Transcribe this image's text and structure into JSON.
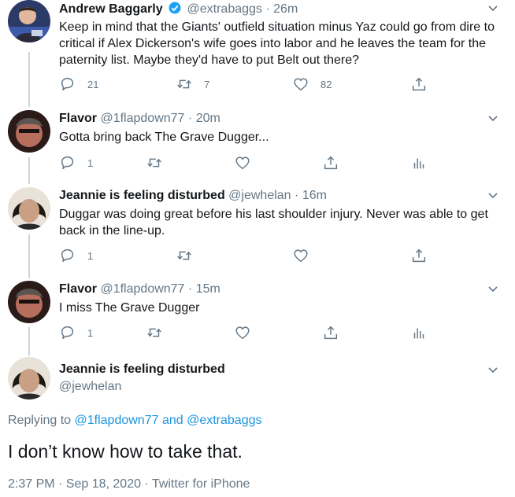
{
  "tweets": [
    {
      "name": "Andrew Baggarly",
      "handle": "@extrabaggs",
      "time": "26m",
      "verified": true,
      "text": "Keep in mind that the Giants' outfield situation minus Yaz could go from dire to critical if Alex Dickerson's wife goes into labor and he leaves the team for the paternity list. Maybe they'd have to put Belt out there?",
      "replies": "21",
      "retweets": "7",
      "likes": "82"
    },
    {
      "name": "Flavor",
      "handle": "@1flapdown77",
      "time": "20m",
      "text": "Gotta bring back The Grave Dugger...",
      "replies": "1"
    },
    {
      "name": "Jeannie is feeling disturbed",
      "handle": "@jewhelan",
      "time": "16m",
      "text": "Duggar was doing great before his last shoulder injury. Never was able to get back in the line-up.",
      "replies": "1"
    },
    {
      "name": "Flavor",
      "handle": "@1flapdown77",
      "time": "15m",
      "text": "I miss The Grave Dugger",
      "replies": "1"
    }
  ],
  "main_tweet": {
    "name": "Jeannie is feeling disturbed",
    "handle": "@jewhelan",
    "replying_prefix": "Replying to",
    "replying_user1": "@1flapdown77",
    "replying_and": "and",
    "replying_user2": "@extrabaggs",
    "text": "I don’t know how to take that.",
    "timestamp": "2:37 PM · Sep 18, 2020 · Twitter for iPhone"
  },
  "separator": "·",
  "colors": {
    "text": "#14171a",
    "secondary": "#657786",
    "link": "#1b95e0",
    "verified": "#1da1f2",
    "thread_line": "#ccd6dd"
  },
  "icons": [
    "reply-icon",
    "retweet-icon",
    "like-icon",
    "share-icon",
    "analytics-icon",
    "chevron-down-icon",
    "verified-badge-icon"
  ]
}
